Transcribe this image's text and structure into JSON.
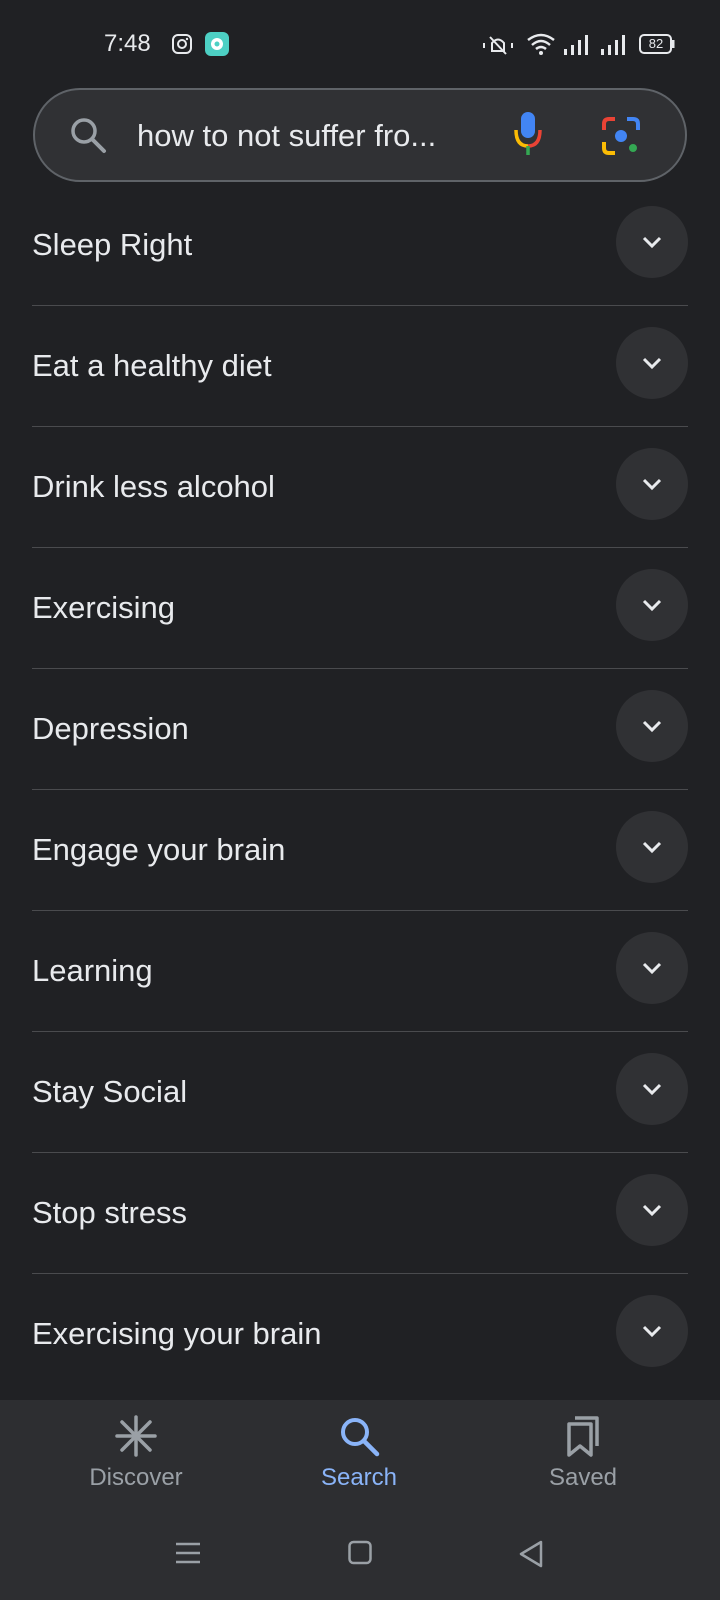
{
  "status_bar": {
    "time": "7:48",
    "battery": "82",
    "icons": [
      "instagram-icon",
      "chat-app-icon",
      "mute-icon",
      "wifi-icon",
      "signal-icon",
      "signal-icon-2",
      "battery-icon"
    ]
  },
  "search": {
    "query": "how to not suffer fro...",
    "icons": [
      "search-icon",
      "mic-icon",
      "lens-icon"
    ]
  },
  "results": [
    {
      "label": "Sleep Right"
    },
    {
      "label": "Eat a healthy diet"
    },
    {
      "label": "Drink less alcohol"
    },
    {
      "label": "Exercising"
    },
    {
      "label": "Depression"
    },
    {
      "label": "Engage your brain"
    },
    {
      "label": "Learning"
    },
    {
      "label": "Stay Social"
    },
    {
      "label": "Stop stress"
    },
    {
      "label": "Exercising your brain"
    }
  ],
  "bottom_nav": {
    "items": [
      {
        "label": "Discover",
        "icon": "discover-icon",
        "active": false
      },
      {
        "label": "Search",
        "icon": "search-icon",
        "active": true
      },
      {
        "label": "Saved",
        "icon": "saved-icon",
        "active": false
      }
    ]
  },
  "colors": {
    "background": "#202124",
    "accent": "#8ab4f8",
    "text": "#e8eaed"
  }
}
